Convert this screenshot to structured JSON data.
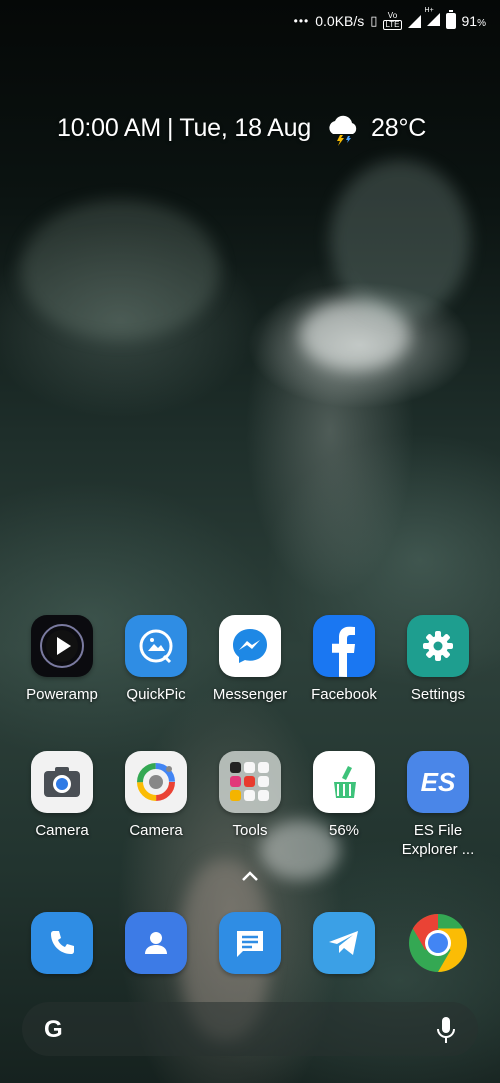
{
  "status_bar": {
    "dots": "•••",
    "net_speed": "0.0KB/s",
    "volte_label": "Vo",
    "lte_label": "LTE",
    "data_label": "H+",
    "battery_pct": "91",
    "battery_unit": "%"
  },
  "glance": {
    "time": "10:00 AM",
    "separator": "|",
    "date": "Tue, 18 Aug",
    "weather_icon": "thunderstorm-cloud-icon",
    "temperature": "28°C"
  },
  "apps_row1": [
    {
      "label": "Poweramp",
      "icon": "poweramp-play-icon"
    },
    {
      "label": "QuickPic",
      "icon": "quickpic-icon"
    },
    {
      "label": "Messenger",
      "icon": "messenger-icon"
    },
    {
      "label": "Facebook",
      "icon": "facebook-icon"
    },
    {
      "label": "Settings",
      "icon": "gear-icon"
    }
  ],
  "apps_row2": [
    {
      "label": "Camera",
      "icon": "camera-icon"
    },
    {
      "label": "Camera",
      "icon": "lens-camera-icon"
    },
    {
      "label": "Tools",
      "icon": "folder-icon"
    },
    {
      "label": "56%",
      "icon": "broom-icon"
    },
    {
      "label": "ES File\nExplorer ...",
      "icon": "es-file-explorer-icon",
      "icon_text": "ES"
    }
  ],
  "dock": [
    {
      "name": "phone",
      "icon": "phone-icon"
    },
    {
      "name": "contacts",
      "icon": "contacts-icon"
    },
    {
      "name": "messages",
      "icon": "message-icon"
    },
    {
      "name": "telegram",
      "icon": "telegram-icon"
    },
    {
      "name": "chrome",
      "icon": "chrome-icon"
    }
  ],
  "search_bar": {
    "logo": "G",
    "mic_icon": "mic-icon"
  },
  "colors": {
    "quickpic": "#2f8de4",
    "messenger_blue": "#1e88e5",
    "facebook": "#1a77f2",
    "settings": "#1e9e8f",
    "es_explorer": "#4a86e8",
    "phone": "#2f8de4",
    "contacts": "#3d7be6",
    "messages": "#2f8de4",
    "telegram": "#3ba0e6",
    "broom_green": "#3ec27a"
  }
}
